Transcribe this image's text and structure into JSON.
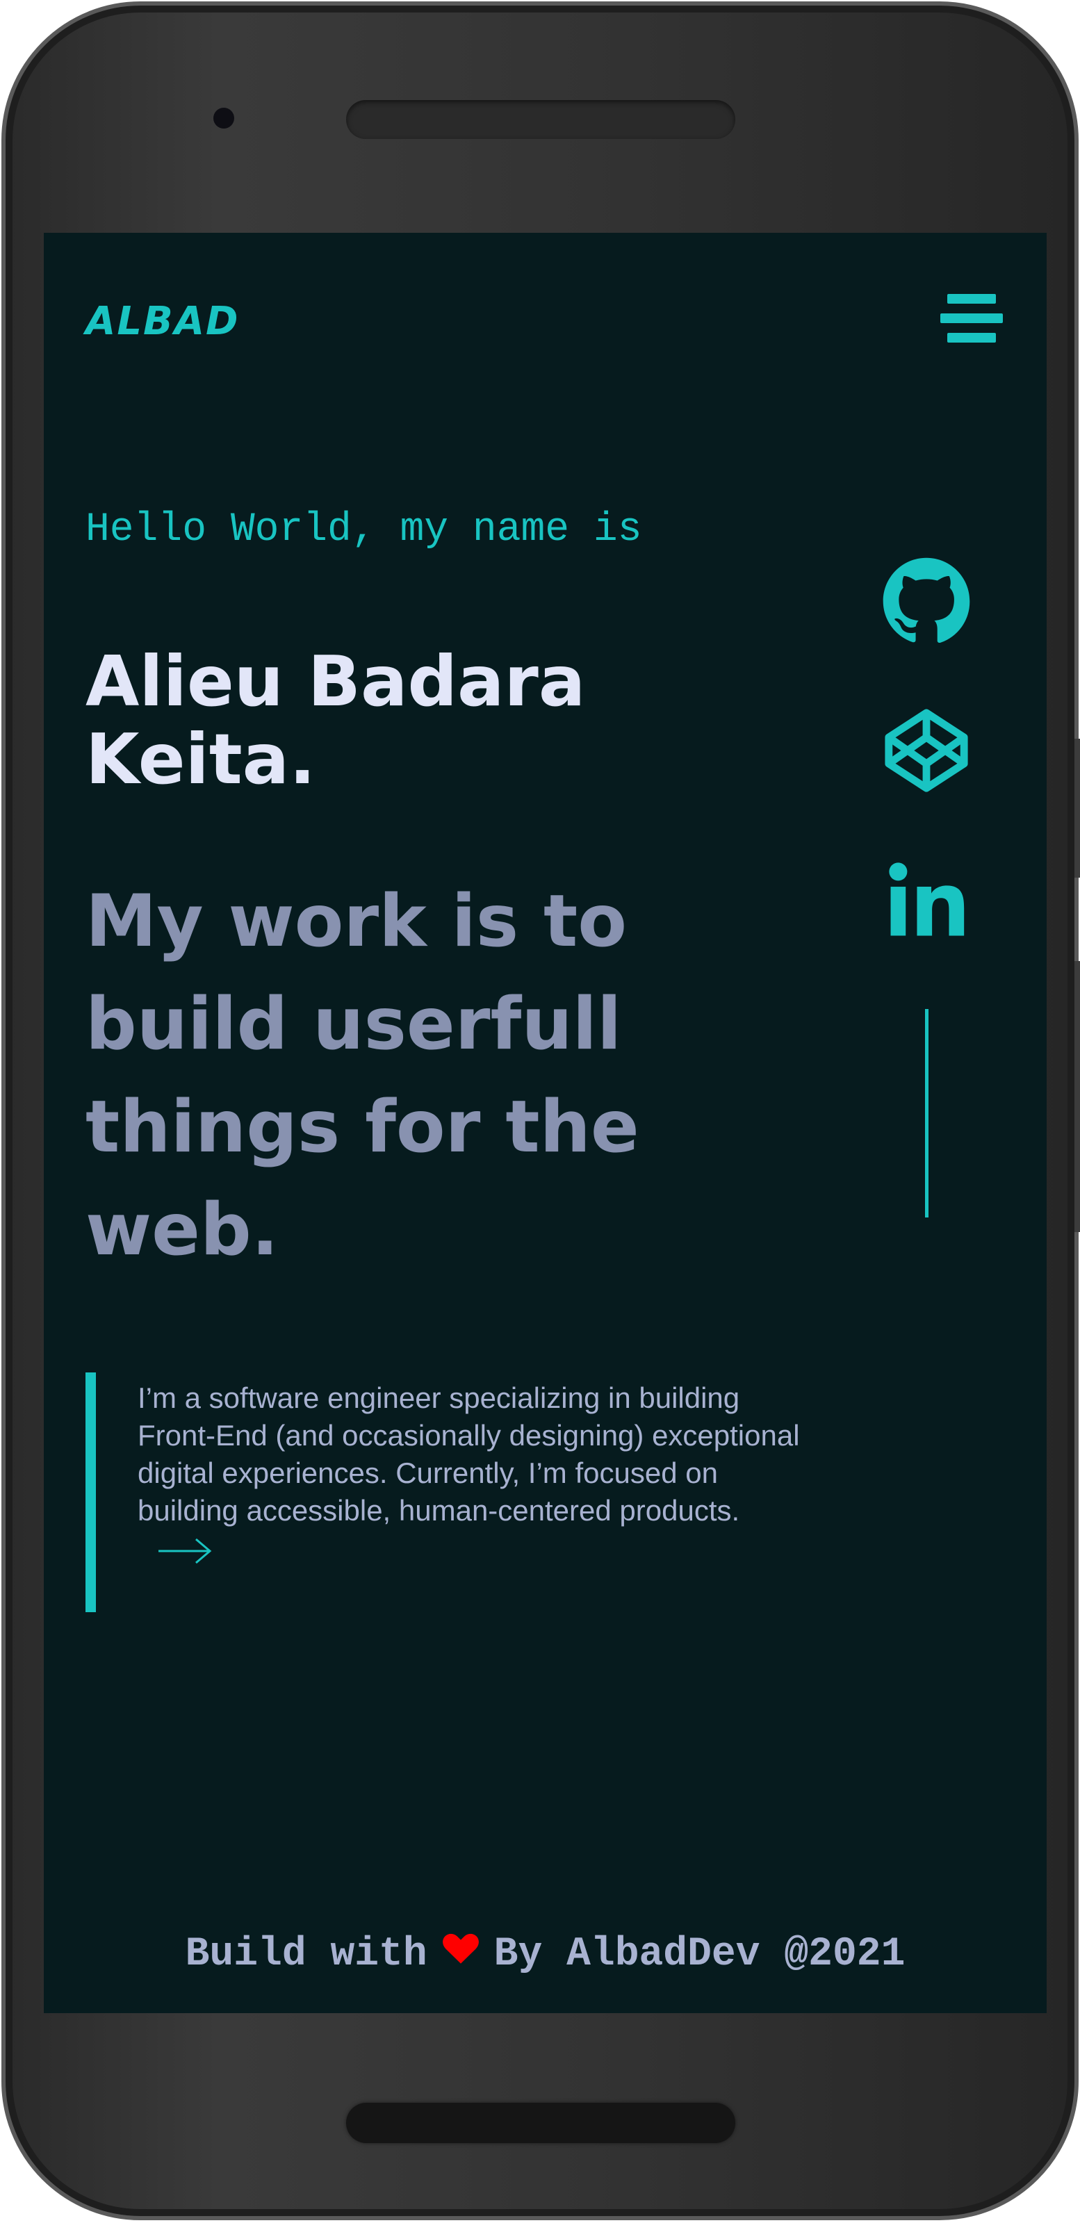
{
  "header": {
    "logo": "ALBAD",
    "menu_icon": "hamburger-menu-icon"
  },
  "hero": {
    "greeting": "Hello World, my name is",
    "name": "Alieu Badara Keita.",
    "tagline": "My work is to build userfull things for the web.",
    "intro": "I’m a software engineer specializing in building Front-End (and occasionally designing) exceptional digital experiences. Currently, I’m focused on building accessible, human-centered products.",
    "arrow_icon": "arrow-right-icon"
  },
  "socials": [
    {
      "icon": "github-icon"
    },
    {
      "icon": "codepen-icon"
    },
    {
      "icon": "linkedin-icon"
    }
  ],
  "footer": {
    "prefix": "Build with",
    "heart_icon": "heart-icon",
    "suffix": "By AlbadDev @2021"
  },
  "colors": {
    "background": "#061b1e",
    "accent": "#19c4c2",
    "heading": "#e2e6f8",
    "muted": "#8892b0",
    "text": "#a8b2d1",
    "heart": "#ff0000",
    "device": "#333333"
  }
}
